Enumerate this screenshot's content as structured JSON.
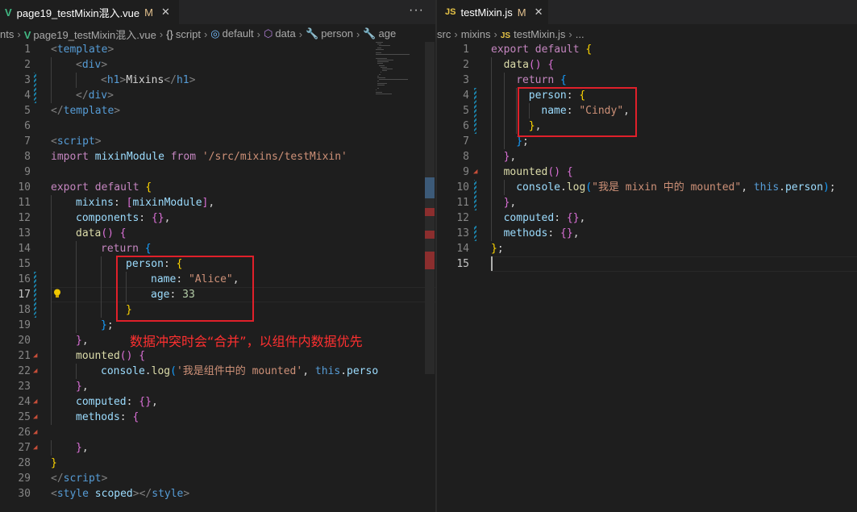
{
  "left_editor": {
    "tab": {
      "title": "page19_testMixin混入.vue",
      "modified": "M",
      "close": "✕"
    },
    "more": "···",
    "breadcrumb": [
      {
        "icon": "none",
        "text": "nts"
      },
      {
        "icon": "vue-file-icon",
        "text": "page19_testMixin混入.vue"
      },
      {
        "icon": "braces-icon",
        "text": "script"
      },
      {
        "icon": "object-icon",
        "text": "default"
      },
      {
        "icon": "cube-icon",
        "text": "data"
      },
      {
        "icon": "wrench-icon",
        "text": "person"
      },
      {
        "icon": "wrench-icon",
        "text": "age"
      }
    ],
    "active_line": 17,
    "lines": [
      {
        "n": "1",
        "indent": 0,
        "tokens": [
          [
            "t-br",
            "<"
          ],
          [
            "t-tag",
            "template"
          ],
          [
            "t-br",
            ">"
          ]
        ]
      },
      {
        "n": "2",
        "indent": 1,
        "tokens": [
          [
            "t-br",
            "<"
          ],
          [
            "t-tag",
            "div"
          ],
          [
            "t-br",
            ">"
          ]
        ]
      },
      {
        "n": "3",
        "indent": 2,
        "tokens": [
          [
            "t-br",
            "<"
          ],
          [
            "t-tag",
            "h1"
          ],
          [
            "t-br",
            ">"
          ],
          [
            "t-txt",
            "Mixins"
          ],
          [
            "t-br",
            "</"
          ],
          [
            "t-tag",
            "h1"
          ],
          [
            "t-br",
            ">"
          ]
        ]
      },
      {
        "n": "4",
        "indent": 1,
        "tokens": [
          [
            "t-br",
            "</"
          ],
          [
            "t-tag",
            "div"
          ],
          [
            "t-br",
            ">"
          ]
        ]
      },
      {
        "n": "5",
        "indent": 0,
        "tokens": [
          [
            "t-br",
            "</"
          ],
          [
            "t-tag",
            "template"
          ],
          [
            "t-br",
            ">"
          ]
        ]
      },
      {
        "n": "6",
        "indent": 0,
        "tokens": []
      },
      {
        "n": "7",
        "indent": 0,
        "tokens": [
          [
            "t-br",
            "<"
          ],
          [
            "t-tag",
            "script"
          ],
          [
            "t-br",
            ">"
          ]
        ]
      },
      {
        "n": "8",
        "indent": 0,
        "tokens": [
          [
            "t-kw",
            "import"
          ],
          [
            "t-txt",
            " "
          ],
          [
            "t-prop",
            "mixinModule"
          ],
          [
            "t-txt",
            " "
          ],
          [
            "t-kw",
            "from"
          ],
          [
            "t-txt",
            " "
          ],
          [
            "t-str",
            "'/src/mixins/testMixin'"
          ]
        ]
      },
      {
        "n": "9",
        "indent": 0,
        "tokens": []
      },
      {
        "n": "10",
        "indent": 0,
        "tokens": [
          [
            "t-kw",
            "export"
          ],
          [
            "t-txt",
            " "
          ],
          [
            "t-kw",
            "default"
          ],
          [
            "t-txt",
            " "
          ],
          [
            "t-b1",
            "{"
          ]
        ]
      },
      {
        "n": "11",
        "indent": 1,
        "tokens": [
          [
            "t-prop",
            "mixins"
          ],
          [
            "t-txt",
            ": "
          ],
          [
            "t-b2",
            "["
          ],
          [
            "t-prop",
            "mixinModule"
          ],
          [
            "t-b2",
            "]"
          ],
          [
            "t-txt",
            ","
          ]
        ]
      },
      {
        "n": "12",
        "indent": 1,
        "tokens": [
          [
            "t-prop",
            "components"
          ],
          [
            "t-txt",
            ": "
          ],
          [
            "t-b2",
            "{}"
          ],
          [
            "t-txt",
            ","
          ]
        ]
      },
      {
        "n": "13",
        "indent": 1,
        "tokens": [
          [
            "t-fn",
            "data"
          ],
          [
            "t-b2",
            "()"
          ],
          [
            "t-txt",
            " "
          ],
          [
            "t-b2",
            "{"
          ]
        ]
      },
      {
        "n": "14",
        "indent": 2,
        "tokens": [
          [
            "t-kw",
            "return"
          ],
          [
            "t-txt",
            " "
          ],
          [
            "t-b3",
            "{"
          ]
        ]
      },
      {
        "n": "15",
        "indent": 3,
        "tokens": [
          [
            "t-prop",
            "person"
          ],
          [
            "t-txt",
            ": "
          ],
          [
            "t-b1",
            "{"
          ]
        ]
      },
      {
        "n": "16",
        "indent": 4,
        "tokens": [
          [
            "t-prop",
            "name"
          ],
          [
            "t-txt",
            ": "
          ],
          [
            "t-str",
            "\"Alice\""
          ],
          [
            "t-txt",
            ","
          ]
        ]
      },
      {
        "n": "17",
        "indent": 4,
        "tokens": [
          [
            "t-prop",
            "age"
          ],
          [
            "t-txt",
            ": "
          ],
          [
            "t-num",
            "33"
          ]
        ]
      },
      {
        "n": "18",
        "indent": 3,
        "tokens": [
          [
            "t-b1",
            "}"
          ]
        ]
      },
      {
        "n": "19",
        "indent": 2,
        "tokens": [
          [
            "t-b3",
            "}"
          ],
          [
            "t-txt",
            ";"
          ]
        ]
      },
      {
        "n": "20",
        "indent": 1,
        "tokens": [
          [
            "t-b2",
            "}"
          ],
          [
            "t-txt",
            ","
          ]
        ]
      },
      {
        "n": "21",
        "indent": 1,
        "tokens": [
          [
            "t-fn",
            "mounted"
          ],
          [
            "t-b2",
            "()"
          ],
          [
            "t-txt",
            " "
          ],
          [
            "t-b2",
            "{"
          ]
        ]
      },
      {
        "n": "22",
        "indent": 2,
        "tokens": [
          [
            "t-prop",
            "console"
          ],
          [
            "t-txt",
            "."
          ],
          [
            "t-fn",
            "log"
          ],
          [
            "t-b3",
            "("
          ],
          [
            "t-str",
            "'我是组件中的 mounted'"
          ],
          [
            "t-txt",
            ", "
          ],
          [
            "t-bl",
            "this"
          ],
          [
            "t-txt",
            "."
          ],
          [
            "t-prop",
            "perso"
          ]
        ]
      },
      {
        "n": "23",
        "indent": 1,
        "tokens": [
          [
            "t-b2",
            "}"
          ],
          [
            "t-txt",
            ","
          ]
        ]
      },
      {
        "n": "24",
        "indent": 1,
        "tokens": [
          [
            "t-prop",
            "computed"
          ],
          [
            "t-txt",
            ": "
          ],
          [
            "t-b2",
            "{}"
          ],
          [
            "t-txt",
            ","
          ]
        ]
      },
      {
        "n": "25",
        "indent": 1,
        "tokens": [
          [
            "t-prop",
            "methods"
          ],
          [
            "t-txt",
            ": "
          ],
          [
            "t-b2",
            "{"
          ]
        ]
      },
      {
        "n": "26",
        "indent": 0,
        "tokens": []
      },
      {
        "n": "27",
        "indent": 1,
        "tokens": [
          [
            "t-b2",
            "}"
          ],
          [
            "t-txt",
            ","
          ]
        ]
      },
      {
        "n": "28",
        "indent": 0,
        "tokens": [
          [
            "t-b1",
            "}"
          ]
        ]
      },
      {
        "n": "29",
        "indent": 0,
        "tokens": [
          [
            "t-br",
            "</"
          ],
          [
            "t-tag",
            "script"
          ],
          [
            "t-br",
            ">"
          ]
        ]
      },
      {
        "n": "30",
        "indent": 0,
        "tokens": [
          [
            "t-br",
            "<"
          ],
          [
            "t-tag",
            "style"
          ],
          [
            "t-txt",
            " "
          ],
          [
            "t-attr",
            "scoped"
          ],
          [
            "t-br",
            "></"
          ],
          [
            "t-tag",
            "style"
          ],
          [
            "t-br",
            ">"
          ]
        ]
      }
    ],
    "annotation": "数据冲突时会“合并”，以组件内数据优先"
  },
  "right_editor": {
    "tab": {
      "icon": "JS",
      "title": "testMixin.js",
      "modified": "M",
      "close": "✕"
    },
    "breadcrumb": [
      {
        "icon": "none",
        "text": "src"
      },
      {
        "icon": "none",
        "text": "mixins"
      },
      {
        "icon": "js-file-icon",
        "text": "testMixin.js"
      },
      {
        "icon": "none",
        "text": "..."
      }
    ],
    "active_line": 15,
    "lines": [
      {
        "n": "1",
        "indent": 0,
        "tokens": [
          [
            "t-kw",
            "export"
          ],
          [
            "t-txt",
            " "
          ],
          [
            "t-kw",
            "default"
          ],
          [
            "t-txt",
            " "
          ],
          [
            "t-b1",
            "{"
          ]
        ]
      },
      {
        "n": "2",
        "indent": 1,
        "tokens": [
          [
            "t-fn",
            "data"
          ],
          [
            "t-b2",
            "()"
          ],
          [
            "t-txt",
            " "
          ],
          [
            "t-b2",
            "{"
          ]
        ]
      },
      {
        "n": "3",
        "indent": 2,
        "tokens": [
          [
            "t-kw",
            "return"
          ],
          [
            "t-txt",
            " "
          ],
          [
            "t-b3",
            "{"
          ]
        ]
      },
      {
        "n": "4",
        "indent": 3,
        "tokens": [
          [
            "t-prop",
            "person"
          ],
          [
            "t-txt",
            ": "
          ],
          [
            "t-b1",
            "{"
          ]
        ]
      },
      {
        "n": "5",
        "indent": 4,
        "tokens": [
          [
            "t-prop",
            "name"
          ],
          [
            "t-txt",
            ": "
          ],
          [
            "t-str",
            "\"Cindy\""
          ],
          [
            "t-txt",
            ","
          ]
        ]
      },
      {
        "n": "6",
        "indent": 3,
        "tokens": [
          [
            "t-b1",
            "}"
          ],
          [
            "t-txt",
            ","
          ]
        ]
      },
      {
        "n": "7",
        "indent": 2,
        "tokens": [
          [
            "t-b3",
            "}"
          ],
          [
            "t-txt",
            ";"
          ]
        ]
      },
      {
        "n": "8",
        "indent": 1,
        "tokens": [
          [
            "t-b2",
            "}"
          ],
          [
            "t-txt",
            ","
          ]
        ]
      },
      {
        "n": "9",
        "indent": 1,
        "tokens": [
          [
            "t-fn",
            "mounted"
          ],
          [
            "t-b2",
            "()"
          ],
          [
            "t-txt",
            " "
          ],
          [
            "t-b2",
            "{"
          ]
        ]
      },
      {
        "n": "10",
        "indent": 2,
        "tokens": [
          [
            "t-prop",
            "console"
          ],
          [
            "t-txt",
            "."
          ],
          [
            "t-fn",
            "log"
          ],
          [
            "t-b3",
            "("
          ],
          [
            "t-str",
            "\"我是 mixin 中的 mounted\""
          ],
          [
            "t-txt",
            ", "
          ],
          [
            "t-bl",
            "this"
          ],
          [
            "t-txt",
            "."
          ],
          [
            "t-prop",
            "person"
          ],
          [
            "t-b3",
            ")"
          ],
          [
            "t-txt",
            ";"
          ]
        ]
      },
      {
        "n": "11",
        "indent": 1,
        "tokens": [
          [
            "t-b2",
            "}"
          ],
          [
            "t-txt",
            ","
          ]
        ]
      },
      {
        "n": "12",
        "indent": 1,
        "tokens": [
          [
            "t-prop",
            "computed"
          ],
          [
            "t-txt",
            ": "
          ],
          [
            "t-b2",
            "{}"
          ],
          [
            "t-txt",
            ","
          ]
        ]
      },
      {
        "n": "13",
        "indent": 1,
        "tokens": [
          [
            "t-prop",
            "methods"
          ],
          [
            "t-txt",
            ": "
          ],
          [
            "t-b2",
            "{}"
          ],
          [
            "t-txt",
            ","
          ]
        ]
      },
      {
        "n": "14",
        "indent": 0,
        "tokens": [
          [
            "t-b1",
            "}"
          ],
          [
            "t-txt",
            ";"
          ]
        ]
      },
      {
        "n": "15",
        "indent": 0,
        "tokens": []
      }
    ]
  },
  "colors": {
    "background": "#1e1e1e",
    "tabbar": "#252526",
    "annotation": "#ff3030",
    "box": "#e0202a"
  }
}
